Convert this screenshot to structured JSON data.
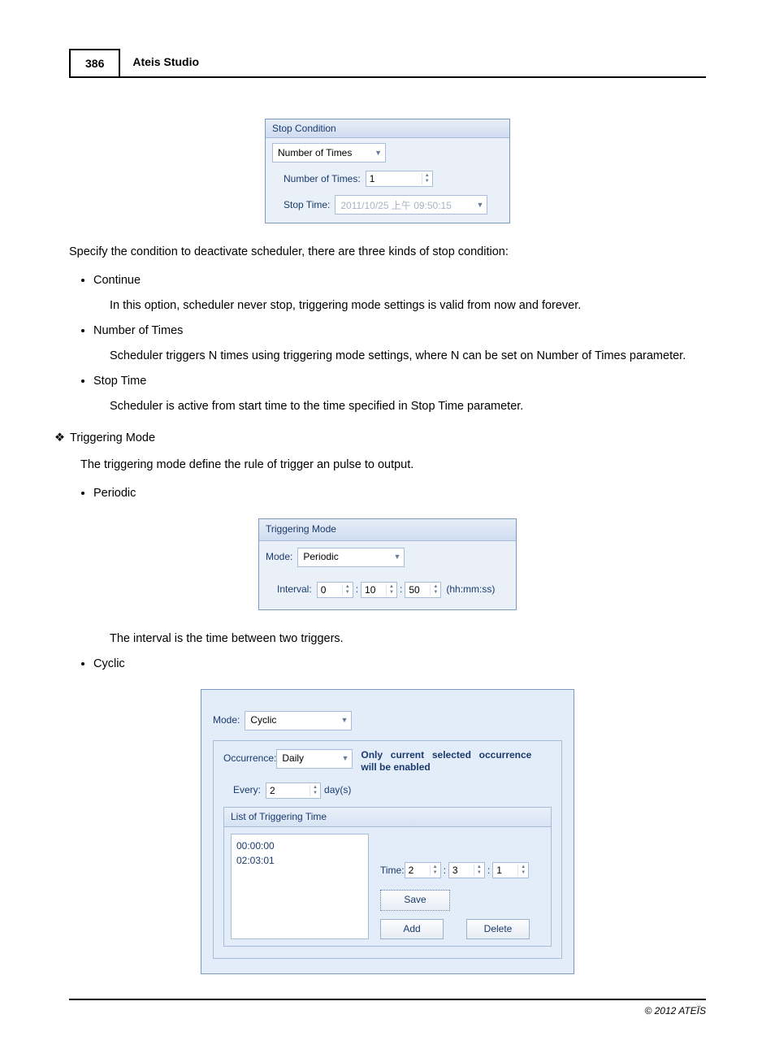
{
  "header": {
    "page_number": "386",
    "title": "Ateis Studio"
  },
  "stop_panel": {
    "title": "Stop Condition",
    "dropdown_value": "Number of Times",
    "num_label": "Number of Times:",
    "num_value": "1",
    "stoptime_label": "Stop Time:",
    "stoptime_value": "2011/10/25 上午 09:50:15"
  },
  "text": {
    "intro": "Specify the condition to deactivate scheduler, there are three kinds of stop condition:",
    "continue_h": "Continue",
    "continue_d": "In this option, scheduler never stop, triggering mode settings is valid from now and forever.",
    "numtimes_h": "Number of Times",
    "numtimes_d": "Scheduler triggers N times using  triggering mode settings, where N can be set on Number of Times parameter.",
    "stoptime_h": "Stop Time",
    "stoptime_d": "Scheduler is active from start time to the time specified in Stop Time parameter.",
    "trig_h": "Triggering Mode",
    "trig_d": "The triggering mode define the rule of trigger an pulse to output.",
    "periodic_h": "Periodic",
    "interval_d": "The interval is the time between two triggers.",
    "cyclic_h": "Cyclic"
  },
  "trig_panel": {
    "title": "Triggering Mode",
    "mode_label": "Mode:",
    "mode_value": "Periodic",
    "interval_label": "Interval:",
    "hh": "0",
    "mm": "10",
    "ss": "50",
    "unit": "(hh:mm:ss)"
  },
  "cyclic_panel": {
    "mode_label": "Mode:",
    "mode_value": "Cyclic",
    "occ_label": "Occurrence:",
    "occ_value": "Daily",
    "note": "Only current selected occurrence will be enabled",
    "every_label": "Every:",
    "every_value": "2",
    "every_unit": "day(s)",
    "list_title": "List of Triggering Time",
    "list_items": [
      "00:00:00",
      "02:03:01"
    ],
    "time_label": "Time:",
    "time_h": "2",
    "time_m": "3",
    "time_s": "1",
    "save_btn": "Save",
    "add_btn": "Add",
    "delete_btn": "Delete"
  },
  "footer": "© 2012 ATEÏS"
}
